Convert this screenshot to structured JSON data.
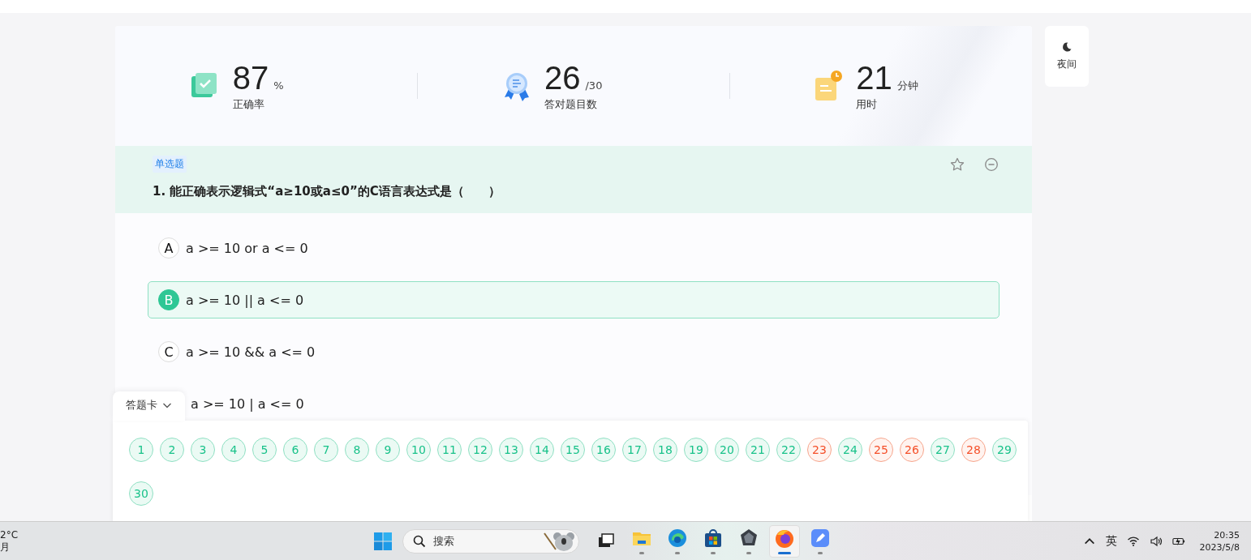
{
  "stats": [
    {
      "kind": "accuracy",
      "value": "87",
      "unit": "%",
      "label": "正确率"
    },
    {
      "kind": "correct",
      "value": "26",
      "unit": "/30",
      "label": "答对题目数"
    },
    {
      "kind": "time",
      "value": "21",
      "unit": "分钟",
      "label": "用时"
    }
  ],
  "night_button": {
    "label": "夜间"
  },
  "question": {
    "type_tag": "单选题",
    "title": "1. 能正确表示逻辑式“a≥10或a≤0”的C语言表达式是（　　）",
    "options": [
      {
        "letter": "A",
        "text": "a >= 10 or a <= 0",
        "selected": false
      },
      {
        "letter": "B",
        "text": "a >= 10 || a <= 0",
        "selected": true
      },
      {
        "letter": "C",
        "text": "a >= 10 && a <= 0",
        "selected": false
      },
      {
        "text": "a >= 10 | a <= 0",
        "selected": false
      }
    ]
  },
  "answer_card": {
    "tab_label": "答题卡",
    "items": [
      {
        "number": "1",
        "correct": true
      },
      {
        "number": "2",
        "correct": true
      },
      {
        "number": "3",
        "correct": true
      },
      {
        "number": "4",
        "correct": true
      },
      {
        "number": "5",
        "correct": true
      },
      {
        "number": "6",
        "correct": true
      },
      {
        "number": "7",
        "correct": true
      },
      {
        "number": "8",
        "correct": true
      },
      {
        "number": "9",
        "correct": true
      },
      {
        "number": "10",
        "correct": true
      },
      {
        "number": "11",
        "correct": true
      },
      {
        "number": "12",
        "correct": true
      },
      {
        "number": "13",
        "correct": true
      },
      {
        "number": "14",
        "correct": true
      },
      {
        "number": "15",
        "correct": true
      },
      {
        "number": "16",
        "correct": true
      },
      {
        "number": "17",
        "correct": true
      },
      {
        "number": "18",
        "correct": true
      },
      {
        "number": "19",
        "correct": true
      },
      {
        "number": "20",
        "correct": true
      },
      {
        "number": "21",
        "correct": true
      },
      {
        "number": "22",
        "correct": true
      },
      {
        "number": "23",
        "correct": false
      },
      {
        "number": "24",
        "correct": true
      },
      {
        "number": "25",
        "correct": false
      },
      {
        "number": "26",
        "correct": false
      },
      {
        "number": "27",
        "correct": true
      },
      {
        "number": "28",
        "correct": false
      },
      {
        "number": "29",
        "correct": true
      },
      {
        "number": "30",
        "correct": true
      }
    ]
  },
  "taskbar": {
    "weather": [
      "2°C",
      "月"
    ],
    "search_placeholder": "搜索",
    "apps": [
      {
        "kind": "taskview",
        "active": false
      },
      {
        "kind": "folder",
        "active": false
      },
      {
        "kind": "edge",
        "active": false
      },
      {
        "kind": "store",
        "active": false
      },
      {
        "kind": "gem",
        "active": false
      },
      {
        "kind": "firefox",
        "active": true
      },
      {
        "kind": "pen",
        "active": false
      }
    ],
    "ime": "英",
    "time": "20:35",
    "date": "2023/5/8"
  }
}
